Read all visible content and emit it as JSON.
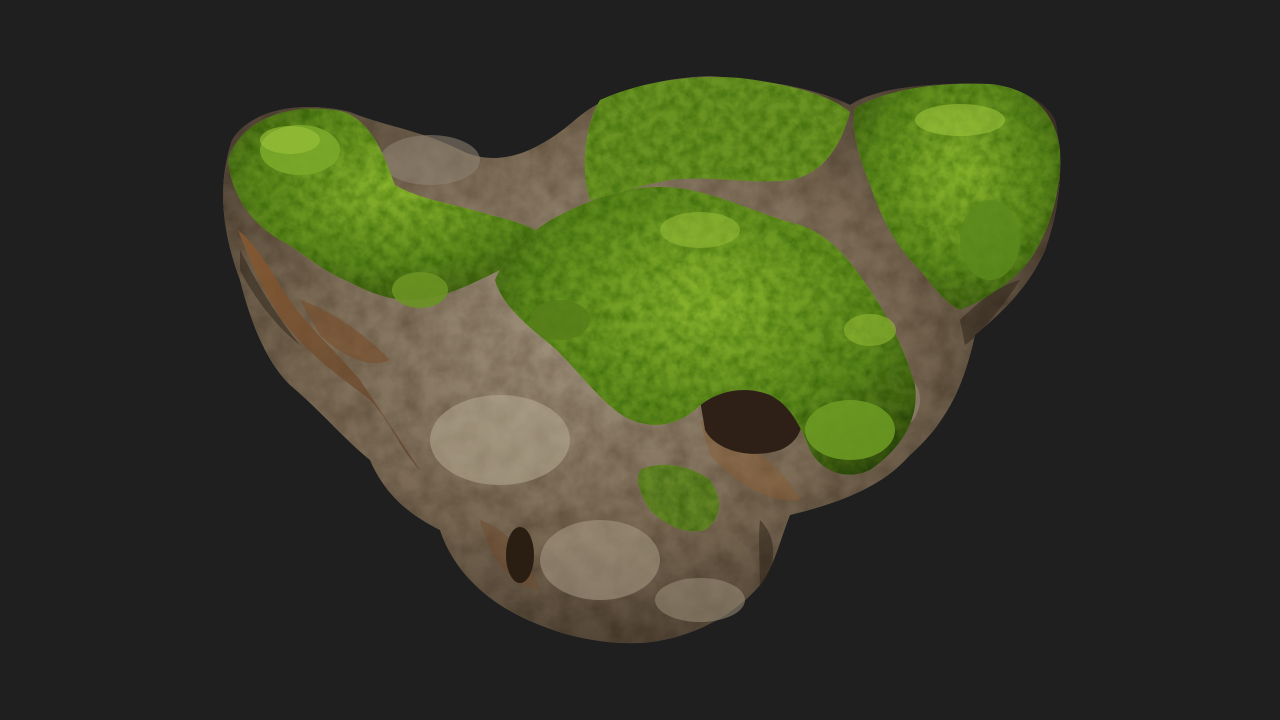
{
  "scene": {
    "background_color": "#1f1f1f",
    "subject_icon": "mossy-rock-icon",
    "colors": {
      "rock_dark": "#4a3e30",
      "rock_mid": "#7d6d58",
      "rock_light": "#a89a84",
      "rock_rust": "#8a5a30",
      "rock_gray": "#6f6a60",
      "moss_dark": "#3f5e12",
      "moss_mid": "#5f8a1c",
      "moss_light": "#86ad2c",
      "hole": "#2a1d12"
    }
  }
}
